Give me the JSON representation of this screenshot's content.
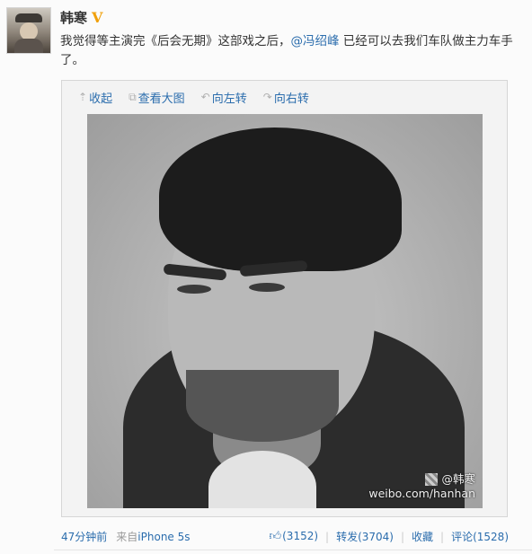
{
  "post": {
    "author": "韩寒",
    "verified_badge": "V",
    "text_before": "我觉得等主演完《后会无期》这部戏之后，",
    "mention": "@冯绍峰",
    "text_after": " 已经可以去我们车队做主力车手了。"
  },
  "toolbar": {
    "collapse": "收起",
    "view_large": "查看大图",
    "rotate_left": "向左转",
    "rotate_right": "向右转"
  },
  "image": {
    "watermark_user": "@韩寒",
    "watermark_url": "weibo.com/hanhan"
  },
  "meta": {
    "time": "47分钟前",
    "source_prefix": "来自",
    "source": "iPhone 5s"
  },
  "actions": {
    "like_count": "(3152)",
    "repost": "转发(3704)",
    "favorite": "收藏",
    "comment": "评论(1528)"
  },
  "colors": {
    "link": "#2b6dad",
    "badge": "#f0a00a"
  },
  "icons": {
    "collapse": "collapse-up-icon",
    "view_large": "enlarge-icon",
    "rotate_left": "rotate-left-icon",
    "rotate_right": "rotate-right-icon",
    "like": "thumbs-up-icon"
  }
}
